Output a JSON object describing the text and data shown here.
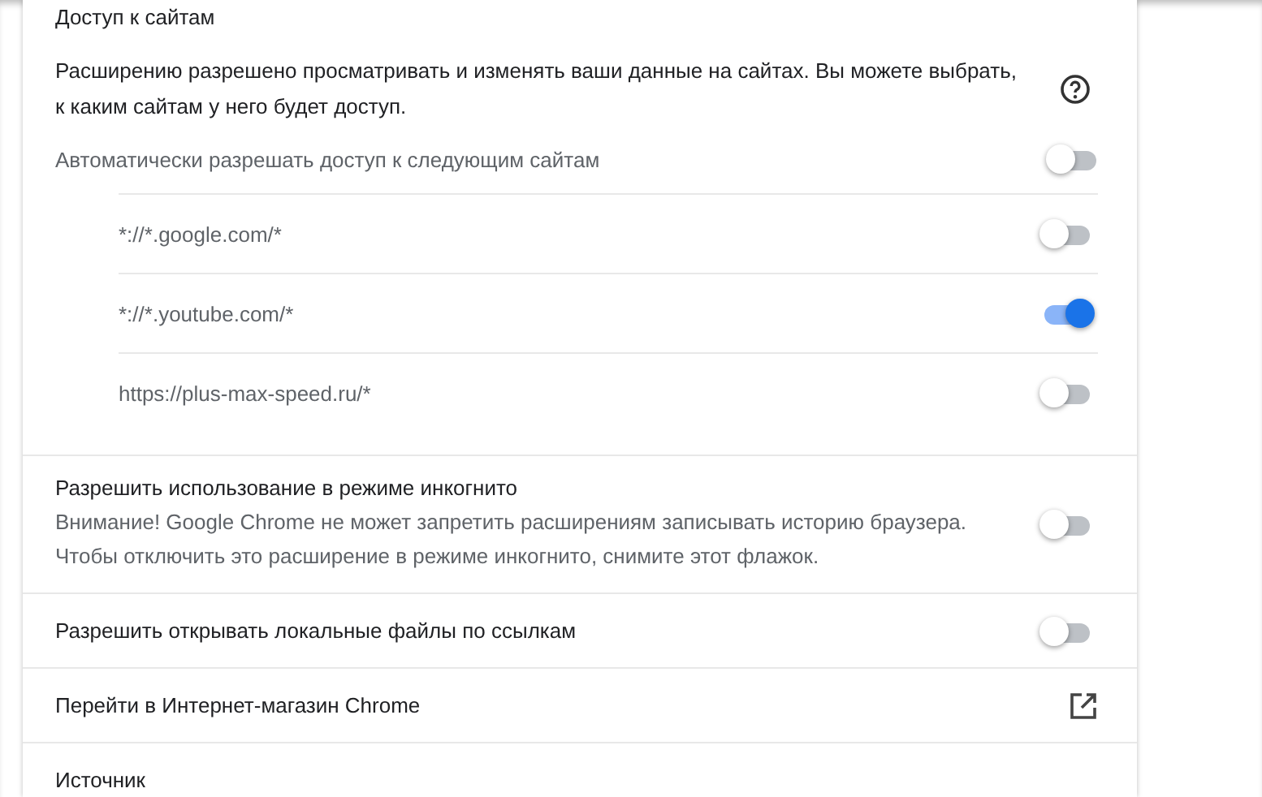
{
  "site_access": {
    "title": "Доступ к сайтам",
    "description": "Расширению разрешено просматривать и изменять ваши данные на сайтах. Вы можете выбрать, к каким сайтам у него будет доступ.",
    "auto_allow": {
      "label": "Автоматически разрешать доступ к следующим сайтам",
      "on": false
    },
    "sites": [
      {
        "label": "*://*.google.com/*",
        "on": false
      },
      {
        "label": "*://*.youtube.com/*",
        "on": true
      },
      {
        "label": "https://plus-max-speed.ru/*",
        "on": false
      }
    ]
  },
  "incognito": {
    "label": "Разрешить использование в режиме инкогнито",
    "note": "Внимание! Google Chrome не может запретить расширениям записывать историю браузера. Чтобы отключить это расширение в режиме инкогнито, снимите этот флажок.",
    "on": false
  },
  "file_urls": {
    "label": "Разрешить открывать локальные файлы по ссылкам",
    "on": false
  },
  "store_link": {
    "label": "Перейти в Интернет-магазин Chrome"
  },
  "source": {
    "label": "Источник"
  }
}
